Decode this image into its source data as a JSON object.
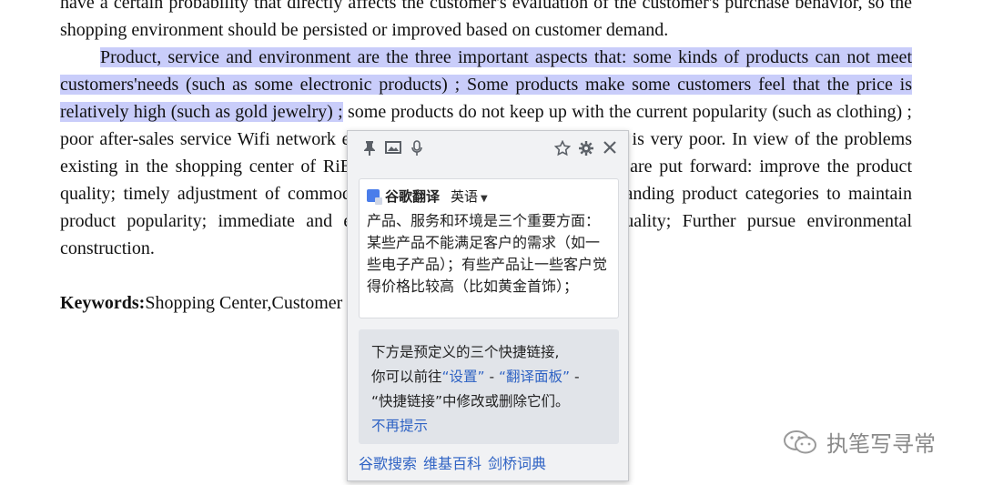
{
  "document": {
    "para1_top": "have a certain probability that directly affects the customer's evaluation of the customer's purchase behavior,",
    "para1_bottom": "so the shopping environment should be persisted or improved based on customer demand.",
    "para2_highlighted": "Product, service and environment are the three important aspects that: some kinds of products can not meet customers'needs (such as some electronic products) ; Some products make some customers feel that the price is relatively high (such as gold jewelry) ;",
    "para2_rest": " some products do not keep up with the current popularity (such as clothing) ; poor after-sales service Wifi network environment and parking environment is very poor. In view of the problems existing in the shopping center of RiBai Group, the following suggestions are put forward: improve the product quality; timely adjustment of commodity prices to benefit customers; Expanding product categories to maintain product popularity; immediate and effective improvement of service quality; Further pursue environmental construction.",
    "keywords_label": "Keywords:",
    "keywords_value": "Shopping Center,Customer Satisfaction,Shopping Environment"
  },
  "popup": {
    "toolbar_icons": [
      "pin-icon",
      "image-icon",
      "microphone-icon",
      "star-icon",
      "gear-icon",
      "close-icon"
    ],
    "service_name": "谷歌翻译",
    "source_language": "英语",
    "translation": "产品、服务和环境是三个重要方面： 某些产品不能满足客户的需求（如一些电子产品）；有些产品让一些客户觉得价格比较高（比如黄金首饰）；",
    "notice_line1": "下方是预定义的三个快捷链接,",
    "notice_line2_prefix": "你可以前往",
    "notice_link_settings": "“设置”",
    "notice_sep1": " - ",
    "notice_link_panel": "“翻译面板”",
    "notice_sep2": " -",
    "notice_line3": "“快捷链接”中修改或删除它们。",
    "dismiss_label": "不再提示",
    "footer_links": [
      "谷歌搜索",
      "维基百科",
      "剑桥词典"
    ]
  },
  "watermark": {
    "text": "执笔写寻常"
  },
  "colors": {
    "highlight": "#c9cdfa",
    "link": "#2f63c4",
    "popup_bg": "#f1f2f4"
  }
}
